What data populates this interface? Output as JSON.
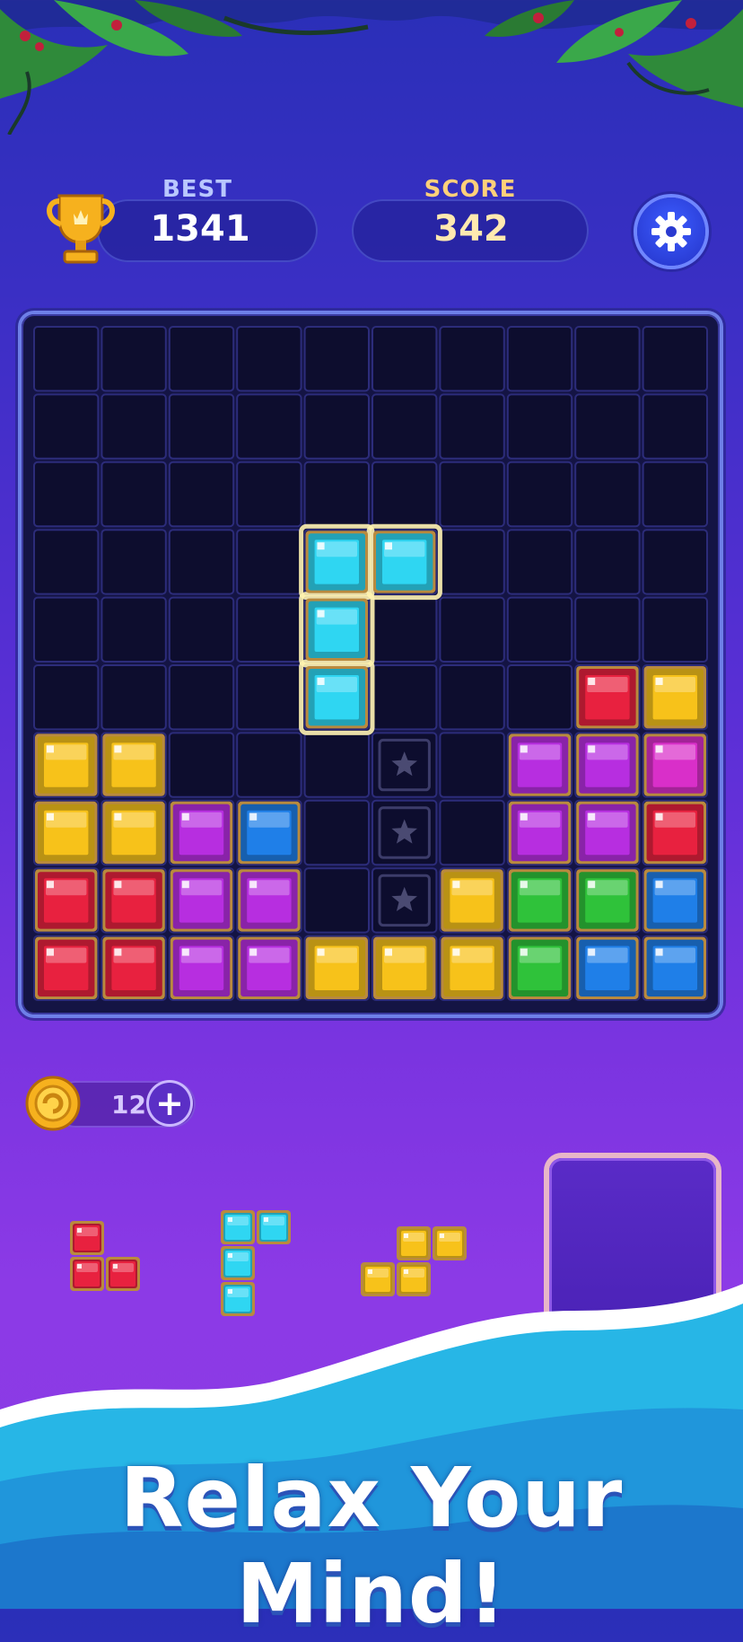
{
  "hud": {
    "best_label": "BEST",
    "best_value": "1341",
    "score_label": "SCORE",
    "score_value": "342"
  },
  "board": {
    "rows": 10,
    "cols": 10,
    "palette": {
      "Y": "#f7c21a",
      "R": "#e8213f",
      "P": "#b72ee0",
      "M": "#d92fc9",
      "B": "#1f7fe8",
      "C": "#2fd6f2",
      "G": "#2fc23a",
      "S": "star",
      ".": "empty"
    },
    "grid": [
      "..........",
      "..........",
      "..........",
      "..........",
      "..........",
      "........RY",
      "YY.....PPM",
      "YYPB.S.PPR",
      "RRPP.SYGGB",
      "RRPPYYYGBB"
    ],
    "highlight_cells": [
      [
        3,
        4
      ],
      [
        3,
        5
      ],
      [
        4,
        4
      ],
      [
        5,
        4
      ]
    ],
    "star_extra": [
      [
        6,
        5
      ]
    ]
  },
  "coins": {
    "count": "12",
    "plus": "+"
  },
  "pieces": [
    {
      "color": "#e8213f",
      "cells": [
        [
          0,
          0
        ],
        [
          1,
          0
        ],
        [
          1,
          1
        ]
      ]
    },
    {
      "color": "#2fd6f2",
      "cells": [
        [
          0,
          0
        ],
        [
          0,
          1
        ],
        [
          1,
          0
        ],
        [
          2,
          0
        ]
      ]
    },
    {
      "color": "#f7c21a",
      "cells": [
        [
          0,
          1
        ],
        [
          0,
          2
        ],
        [
          1,
          0
        ],
        [
          1,
          1
        ]
      ]
    }
  ],
  "tagline": "Relax Your Mind!",
  "colors": {
    "board_bg": "#141444",
    "cell_bg": "#0d0d2e",
    "glow": "#fff3b0"
  }
}
